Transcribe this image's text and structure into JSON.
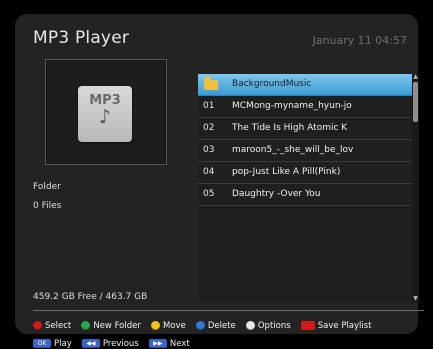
{
  "header": {
    "title": "MP3 Player",
    "datetime": "January 11 04:57"
  },
  "left": {
    "thumbnail": {
      "label": "MP3",
      "icon": "music-note-icon"
    },
    "folder_label": "Folder",
    "files_count": "0 Files",
    "storage": "459.2 GB Free / 463.7 GB"
  },
  "list": {
    "selected_index": 0,
    "items": [
      {
        "index": "",
        "name": "BackgroundMusic",
        "type": "folder",
        "icon": "folder-icon"
      },
      {
        "index": "01",
        "name": "MCMong-myname_hyun-jo",
        "type": "file"
      },
      {
        "index": "02",
        "name": "The Tide Is High   Atomic K",
        "type": "file"
      },
      {
        "index": "03",
        "name": "maroon5_-_she_will_be_lov",
        "type": "file"
      },
      {
        "index": "04",
        "name": "pop-Just Like A Pill(Pink)",
        "type": "file"
      },
      {
        "index": "05",
        "name": "Daughtry -Over You",
        "type": "file"
      }
    ]
  },
  "footer": {
    "row1": [
      {
        "color": "red",
        "label": "Select"
      },
      {
        "color": "green",
        "label": "New Folder"
      },
      {
        "color": "yellow",
        "label": "Move"
      },
      {
        "color": "blue",
        "label": "Delete"
      },
      {
        "color": "white",
        "label": "Options"
      },
      {
        "color": "red",
        "label": "Save Playlist"
      }
    ],
    "row2": [
      {
        "key": "OK",
        "label": "Play"
      },
      {
        "key": "◀◀",
        "label": "Previous"
      },
      {
        "key": "▶▶",
        "label": "Next"
      }
    ]
  }
}
